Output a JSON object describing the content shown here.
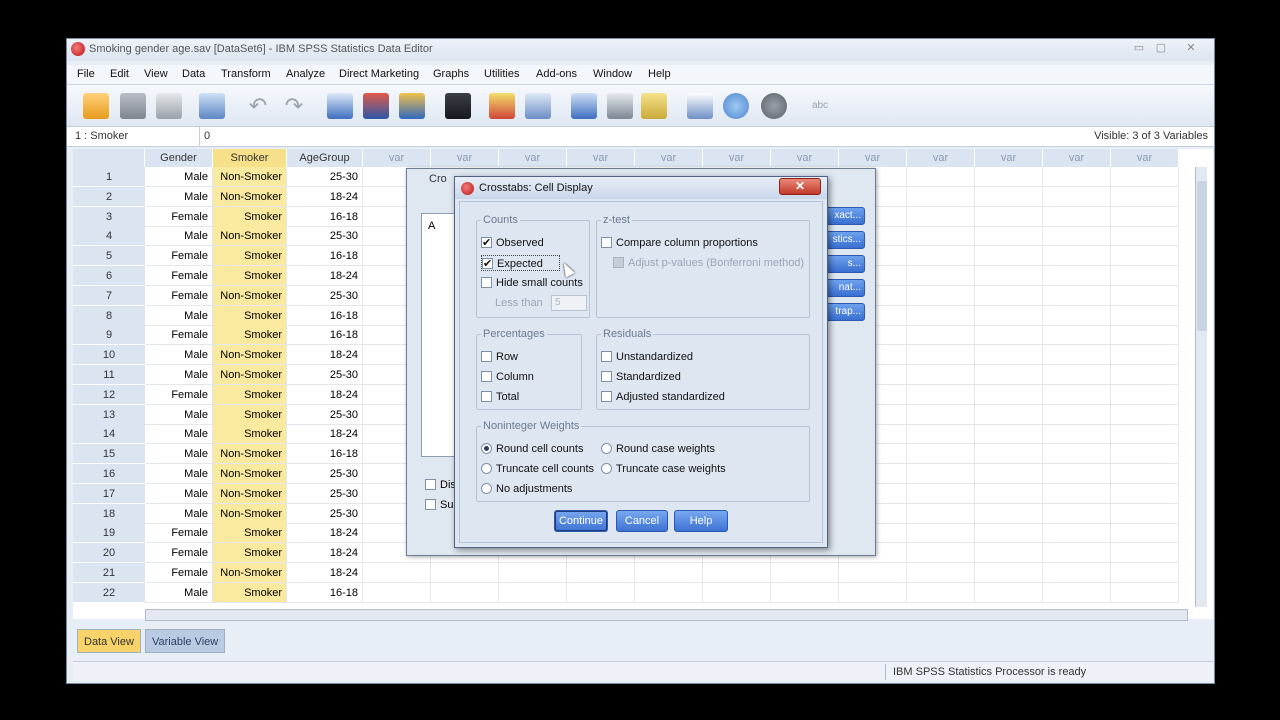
{
  "window": {
    "title": "Smoking gender age.sav [DataSet6] - IBM SPSS Statistics Data Editor",
    "controls": [
      "▭",
      "▢",
      "✕"
    ]
  },
  "menu": [
    "File",
    "Edit",
    "View",
    "Data",
    "Transform",
    "Analyze",
    "Direct Marketing",
    "Graphs",
    "Utilities",
    "Add-ons",
    "Window",
    "Help"
  ],
  "toolbar_icons": [
    "open-folder-icon",
    "save-icon",
    "print-icon",
    "recall-dialog-icon",
    "undo-icon",
    "redo-icon",
    "goto-case-icon",
    "goto-variable-icon",
    "variables-icon",
    "find-icon",
    "insert-cases-icon",
    "insert-variable-icon",
    "split-file-icon",
    "weight-cases-icon",
    "select-cases-icon",
    "value-labels-icon",
    "use-sets-icon",
    "show-all-variables-icon",
    "spell-check-icon"
  ],
  "cellbar": {
    "ref": "1 : Smoker",
    "value": "0",
    "visible": "Visible: 3 of 3 Variables"
  },
  "grid": {
    "columns": [
      "Gender",
      "Smoker",
      "AgeGroup",
      "var",
      "var",
      "var",
      "var",
      "var",
      "var",
      "var",
      "var",
      "var",
      "var",
      "var",
      "var"
    ],
    "rows": [
      {
        "n": "1",
        "gender": "Male",
        "smoker": "Non-Smoker",
        "age": "25-30"
      },
      {
        "n": "2",
        "gender": "Male",
        "smoker": "Non-Smoker",
        "age": "18-24"
      },
      {
        "n": "3",
        "gender": "Female",
        "smoker": "Smoker",
        "age": "16-18"
      },
      {
        "n": "4",
        "gender": "Male",
        "smoker": "Non-Smoker",
        "age": "25-30"
      },
      {
        "n": "5",
        "gender": "Female",
        "smoker": "Smoker",
        "age": "16-18"
      },
      {
        "n": "6",
        "gender": "Female",
        "smoker": "Smoker",
        "age": "18-24"
      },
      {
        "n": "7",
        "gender": "Female",
        "smoker": "Non-Smoker",
        "age": "25-30"
      },
      {
        "n": "8",
        "gender": "Male",
        "smoker": "Smoker",
        "age": "16-18"
      },
      {
        "n": "9",
        "gender": "Female",
        "smoker": "Smoker",
        "age": "16-18"
      },
      {
        "n": "10",
        "gender": "Male",
        "smoker": "Non-Smoker",
        "age": "18-24"
      },
      {
        "n": "11",
        "gender": "Male",
        "smoker": "Non-Smoker",
        "age": "25-30"
      },
      {
        "n": "12",
        "gender": "Female",
        "smoker": "Smoker",
        "age": "18-24"
      },
      {
        "n": "13",
        "gender": "Male",
        "smoker": "Smoker",
        "age": "25-30"
      },
      {
        "n": "14",
        "gender": "Male",
        "smoker": "Smoker",
        "age": "18-24"
      },
      {
        "n": "15",
        "gender": "Male",
        "smoker": "Non-Smoker",
        "age": "16-18"
      },
      {
        "n": "16",
        "gender": "Male",
        "smoker": "Non-Smoker",
        "age": "25-30"
      },
      {
        "n": "17",
        "gender": "Male",
        "smoker": "Non-Smoker",
        "age": "25-30"
      },
      {
        "n": "18",
        "gender": "Male",
        "smoker": "Non-Smoker",
        "age": "25-30"
      },
      {
        "n": "19",
        "gender": "Female",
        "smoker": "Smoker",
        "age": "18-24"
      },
      {
        "n": "20",
        "gender": "Female",
        "smoker": "Smoker",
        "age": "18-24"
      },
      {
        "n": "21",
        "gender": "Female",
        "smoker": "Non-Smoker",
        "age": "18-24"
      },
      {
        "n": "22",
        "gender": "Male",
        "smoker": "Smoker",
        "age": "16-18"
      }
    ]
  },
  "tabs": {
    "data_view": "Data View",
    "variable_view": "Variable View"
  },
  "status": "IBM SPSS Statistics Processor is ready",
  "crosstabs_dialog": {
    "title": "Cro",
    "list_item": "A",
    "checkbox1": "Dis",
    "checkbox2": "Su",
    "side_buttons": [
      "xact...",
      "stics...",
      "s...",
      "nat...",
      "trap..."
    ]
  },
  "cell_display": {
    "title": "Crosstabs: Cell Display",
    "close": "✕",
    "counts": {
      "label": "Counts",
      "observed": {
        "label": "Observed",
        "checked": true
      },
      "expected": {
        "label": "Expected",
        "checked": true
      },
      "hide_small": {
        "label": "Hide small counts",
        "checked": false
      },
      "less_than": "Less than",
      "less_than_value": "5"
    },
    "ztest": {
      "label": "z-test",
      "compare": "Compare column proportions",
      "adjust": "Adjust p-values (Bonferroni method)"
    },
    "percentages": {
      "label": "Percentages",
      "row": "Row",
      "column": "Column",
      "total": "Total"
    },
    "residuals": {
      "label": "Residuals",
      "unstandardized": "Unstandardized",
      "standardized": "Standardized",
      "adjusted": "Adjusted standardized"
    },
    "weights": {
      "label": "Noninteger Weights",
      "round_cell": "Round cell counts",
      "round_case": "Round case weights",
      "truncate_cell": "Truncate cell counts",
      "truncate_case": "Truncate case weights",
      "none": "No adjustments",
      "selected": "round_cell"
    },
    "buttons": {
      "continue": "Continue",
      "cancel": "Cancel",
      "help": "Help"
    }
  },
  "colors": {
    "smoker_highlight": "#f7e08a",
    "header_bg": "#dbe5f2",
    "button_blue": "#3c72d3",
    "close_red": "#c3392a"
  }
}
